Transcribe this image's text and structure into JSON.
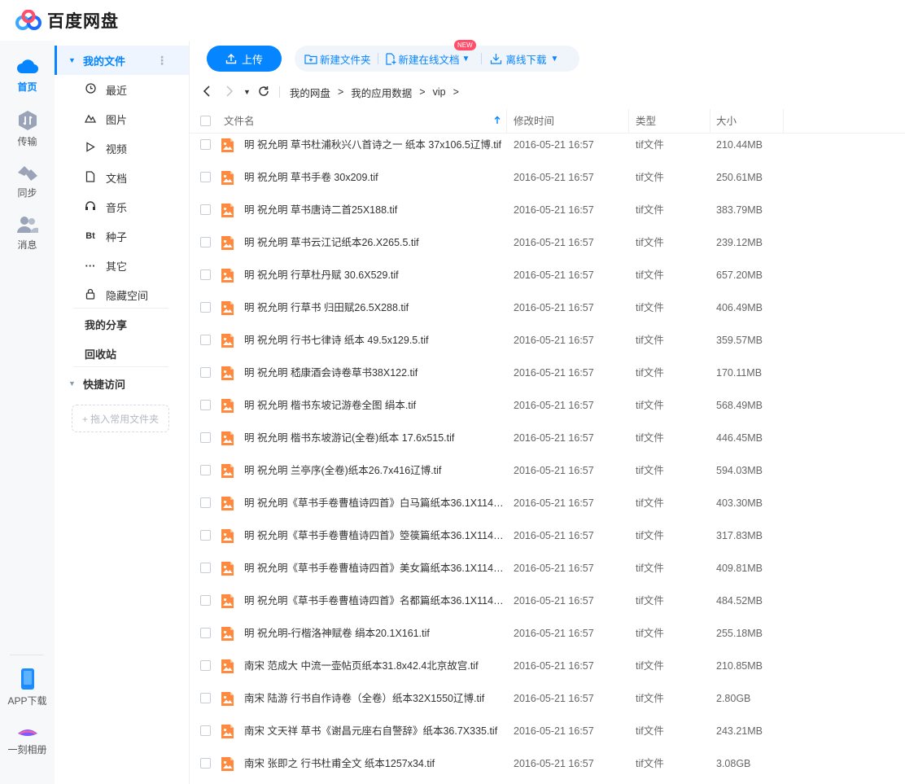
{
  "app": {
    "title": "百度网盘"
  },
  "colors": {
    "accent": "#0585ff",
    "file_icon": "#ff8a3d",
    "new_badge": "#ff4d6a"
  },
  "leftnav": {
    "items": [
      {
        "label": "首页",
        "icon": "cloud-icon",
        "active": true
      },
      {
        "label": "传输",
        "icon": "transfer-icon"
      },
      {
        "label": "同步",
        "icon": "sync-icon"
      },
      {
        "label": "消息",
        "icon": "message-icon"
      }
    ],
    "bottom": [
      {
        "label": "APP下载",
        "icon": "phone-icon"
      },
      {
        "label": "一刻相册",
        "icon": "album-icon"
      }
    ]
  },
  "sidebar": {
    "my_files": "我的文件",
    "categories": [
      {
        "label": "最近",
        "icon": "clock-icon"
      },
      {
        "label": "图片",
        "icon": "image-icon"
      },
      {
        "label": "视频",
        "icon": "play-icon"
      },
      {
        "label": "文档",
        "icon": "document-icon"
      },
      {
        "label": "音乐",
        "icon": "headphone-icon"
      },
      {
        "label": "种子",
        "icon": "bt-icon",
        "glyph": "Bt"
      },
      {
        "label": "其它",
        "icon": "more-icon"
      },
      {
        "label": "隐藏空间",
        "icon": "lock-icon"
      }
    ],
    "my_share": "我的分享",
    "recycle": "回收站",
    "quick_access": "快捷访问",
    "drop_hint": "+ 拖入常用文件夹"
  },
  "toolbar": {
    "upload": "上传",
    "new_folder": "新建文件夹",
    "new_online_doc": "新建在线文档",
    "new_badge": "NEW",
    "offline_download": "离线下载"
  },
  "breadcrumb": [
    "我的网盘",
    "我的应用数据",
    "vip"
  ],
  "table": {
    "headers": {
      "name": "文件名",
      "modified": "修改时间",
      "type": "类型",
      "size": "大小"
    },
    "rows": [
      {
        "name": "明 祝允明 草书杜浦秋兴八首诗之一 纸本 37x106.5辽博.tif",
        "modified": "2016-05-21 16:57",
        "type": "tif文件",
        "size": "210.44MB"
      },
      {
        "name": "明 祝允明 草书手卷 30x209.tif",
        "modified": "2016-05-21 16:57",
        "type": "tif文件",
        "size": "250.61MB"
      },
      {
        "name": "明 祝允明 草书唐诗二首25X188.tif",
        "modified": "2016-05-21 16:57",
        "type": "tif文件",
        "size": "383.79MB"
      },
      {
        "name": "明 祝允明 草书云江记纸本26.X265.5.tif",
        "modified": "2016-05-21 16:57",
        "type": "tif文件",
        "size": "239.12MB"
      },
      {
        "name": "明 祝允明 行草杜丹赋 30.6X529.tif",
        "modified": "2016-05-21 16:57",
        "type": "tif文件",
        "size": "657.20MB"
      },
      {
        "name": "明 祝允明 行草书 归田赋26.5X288.tif",
        "modified": "2016-05-21 16:57",
        "type": "tif文件",
        "size": "406.49MB"
      },
      {
        "name": "明 祝允明 行书七律诗 纸本 49.5x129.5.tif",
        "modified": "2016-05-21 16:57",
        "type": "tif文件",
        "size": "359.57MB"
      },
      {
        "name": "明 祝允明 嵇康酒会诗卷草书38X122.tif",
        "modified": "2016-05-21 16:57",
        "type": "tif文件",
        "size": "170.11MB"
      },
      {
        "name": "明 祝允明 楷书东坡记游卷全图 绢本.tif",
        "modified": "2016-05-21 16:57",
        "type": "tif文件",
        "size": "568.49MB"
      },
      {
        "name": "明 祝允明 楷书东坡游记(全卷)纸本 17.6x515.tif",
        "modified": "2016-05-21 16:57",
        "type": "tif文件",
        "size": "446.45MB"
      },
      {
        "name": "明 祝允明 兰亭序(全卷)纸本26.7x416辽博.tif",
        "modified": "2016-05-21 16:57",
        "type": "tif文件",
        "size": "594.03MB"
      },
      {
        "name": "明 祝允明《草书手卷曹植诗四首》白马篇纸本36.1X1147...",
        "modified": "2016-05-21 16:57",
        "type": "tif文件",
        "size": "403.30MB"
      },
      {
        "name": "明 祝允明《草书手卷曹植诗四首》箜篌篇纸本36.1X1147...",
        "modified": "2016-05-21 16:57",
        "type": "tif文件",
        "size": "317.83MB"
      },
      {
        "name": "明 祝允明《草书手卷曹植诗四首》美女篇纸本36.1X1147...",
        "modified": "2016-05-21 16:57",
        "type": "tif文件",
        "size": "409.81MB"
      },
      {
        "name": "明 祝允明《草书手卷曹植诗四首》名都篇纸本36.1X1147...",
        "modified": "2016-05-21 16:57",
        "type": "tif文件",
        "size": "484.52MB"
      },
      {
        "name": "明 祝允明-行楷洛神赋卷 绢本20.1X161.tif",
        "modified": "2016-05-21 16:57",
        "type": "tif文件",
        "size": "255.18MB"
      },
      {
        "name": "南宋 范成大 中流一壶帖页纸本31.8x42.4北京故宫.tif",
        "modified": "2016-05-21 16:57",
        "type": "tif文件",
        "size": "210.85MB"
      },
      {
        "name": "南宋 陆游 行书自作诗卷（全卷）纸本32X1550辽博.tif",
        "modified": "2016-05-21 16:57",
        "type": "tif文件",
        "size": "2.80GB"
      },
      {
        "name": "南宋 文天祥 草书《谢昌元座右自警辞》纸本36.7X335.tif",
        "modified": "2016-05-21 16:57",
        "type": "tif文件",
        "size": "243.21MB"
      },
      {
        "name": "南宋 张即之 行书杜甫全文 纸本1257x34.tif",
        "modified": "2016-05-21 16:57",
        "type": "tif文件",
        "size": "3.08GB"
      }
    ]
  }
}
